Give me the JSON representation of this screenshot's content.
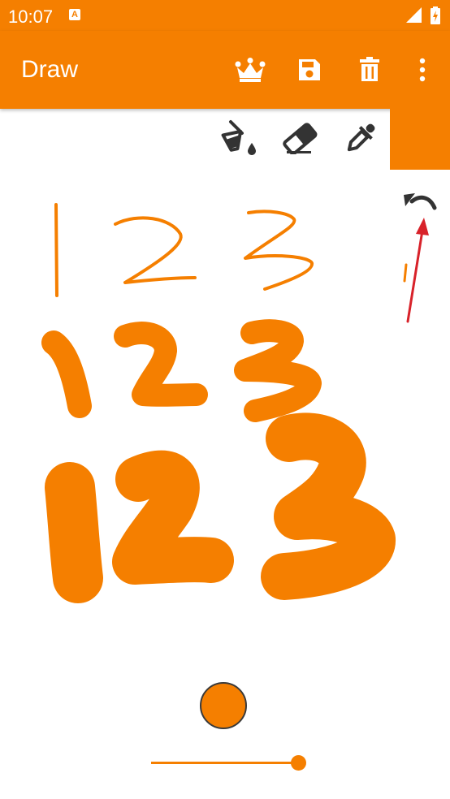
{
  "status_bar": {
    "time": "10:07",
    "notification_badge": "A"
  },
  "app_bar": {
    "title": "Draw",
    "actions": [
      {
        "name": "premium",
        "icon": "crown-icon"
      },
      {
        "name": "save",
        "icon": "save-icon"
      },
      {
        "name": "delete",
        "icon": "trash-icon"
      },
      {
        "name": "more",
        "icon": "more-vert-icon"
      }
    ]
  },
  "tools": [
    {
      "name": "fill",
      "icon": "paint-bucket-icon"
    },
    {
      "name": "eraser",
      "icon": "eraser-icon"
    },
    {
      "name": "color-picker",
      "icon": "eyedropper-icon"
    }
  ],
  "colors": {
    "accent": "#f57f00",
    "stroke": "#f57f00",
    "icon_dark": "#333333",
    "arrow": "#d8222a"
  },
  "brush": {
    "size_level": 1.0
  }
}
